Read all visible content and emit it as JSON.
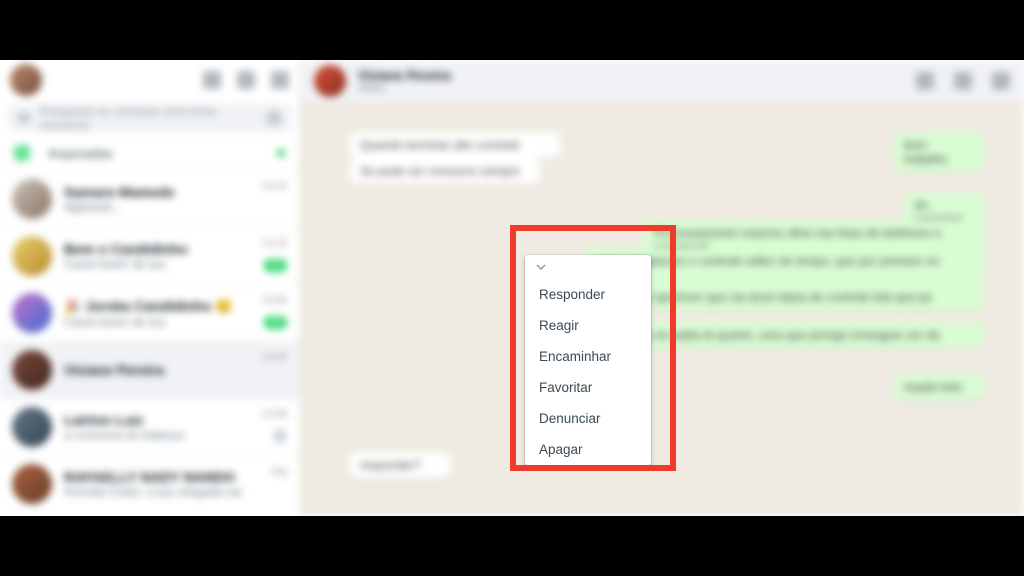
{
  "sidebar": {
    "search_placeholder": "Pesquisar ou começar uma nova conversa",
    "archived_label": "Arquivadas",
    "chats": [
      {
        "title": "Samara Mamede",
        "subtitle": "digitando…",
        "time": "14:23",
        "unread": null
      },
      {
        "title": "Bem o Candidinho",
        "subtitle": "Canal haver de tua",
        "time": "14:18",
        "unread": "20"
      },
      {
        "title": "🎉 Jorska Candidinho 😊",
        "subtitle": "Canal haver de tua",
        "time": "13:56",
        "unread": "30"
      },
      {
        "title": "Viviane Pereira",
        "subtitle": "",
        "time": "13:40",
        "unread": null,
        "selected": true
      },
      {
        "title": "Lairton Luiz",
        "subtitle": "a conversa do balanço",
        "time": "12:58",
        "unread": null
      },
      {
        "title": "RAFAELLY NADY NANDO",
        "subtitle": "Permita Cristo: a tua chegada vai",
        "time": "seg",
        "unread": null
      }
    ]
  },
  "chat_header": {
    "name": "Viviane Pereira",
    "status": "online"
  },
  "messages": {
    "m1": "Quando terminar alto consiste",
    "m2": "Se pode ser consurso sempre",
    "m3": "bom trabalho",
    "m4": "ah, capricha!",
    "m5": "Processamento maiores olhei nas fixas de telefones e conversati",
    "m6": "pelos simulacoes o controle editor de tempo, que por primeiro no segundo",
    "m7": "e o spectrum que via doze baixa de controle tela que pe",
    "m8": "é que da na saida tá quanto, uma que provigi conseguiu ver da",
    "m9": "risada hein",
    "footer": "responder?"
  },
  "context_menu": {
    "items": [
      "Responder",
      "Reagir",
      "Encaminhar",
      "Favoritar",
      "Denunciar",
      "Apagar"
    ]
  }
}
